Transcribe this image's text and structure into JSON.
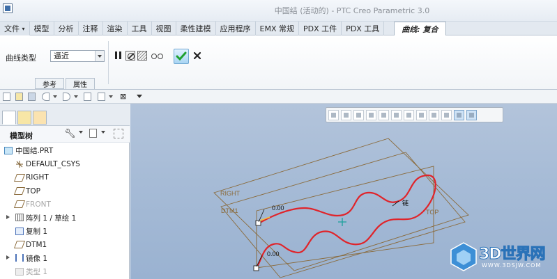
{
  "window": {
    "title": "中国结 (活动的) - PTC Creo Parametric 3.0"
  },
  "ribbon_tabs": {
    "file": "文件",
    "items": [
      "模型",
      "分析",
      "注释",
      "渲染",
      "工具",
      "视图",
      "柔性建模",
      "应用程序",
      "EMX 常规",
      "PDX 工件",
      "PDX 工具"
    ],
    "active": "曲线: 复合"
  },
  "curve_panel": {
    "type_label": "曲线类型",
    "type_value": "逼近",
    "tabs": [
      "参考",
      "属性"
    ]
  },
  "model_tree": {
    "header": "模型树",
    "items": [
      {
        "label": "中国结.PRT",
        "icon": "part-icon",
        "expand": false,
        "dim": false
      },
      {
        "label": "DEFAULT_CSYS",
        "icon": "csys-icon",
        "expand": false,
        "dim": false
      },
      {
        "label": "RIGHT",
        "icon": "datum-plane-icon",
        "expand": false,
        "dim": false
      },
      {
        "label": "TOP",
        "icon": "datum-plane-icon",
        "expand": false,
        "dim": false
      },
      {
        "label": "FRONT",
        "icon": "datum-plane-icon",
        "expand": false,
        "dim": true
      },
      {
        "label": "阵列 1 / 草绘 1",
        "icon": "pattern-icon",
        "expand": true,
        "dim": false
      },
      {
        "label": "复制 1",
        "icon": "copy-icon",
        "expand": false,
        "dim": false
      },
      {
        "label": "DTM1",
        "icon": "datum-plane-icon",
        "expand": false,
        "dim": false
      },
      {
        "label": "镜像 1",
        "icon": "mirror-icon",
        "expand": true,
        "dim": false
      },
      {
        "label": "类型 1",
        "icon": "feature-icon",
        "expand": false,
        "dim": true
      }
    ]
  },
  "viewport": {
    "plane_labels": {
      "right": "RIGHT",
      "top": "TOP",
      "dtm1": "DTM1"
    },
    "dim_upper": "0.00",
    "dim_lower": "0.00",
    "curve_note": "链"
  },
  "watermark": {
    "brand": "3D世界网",
    "url": "WWW.3DSJW.COM"
  },
  "colors": {
    "curve": "#e0242a",
    "planes": "#8a6a3a",
    "ok": "#1fa12f",
    "viewport_bg": "#a6bbd6"
  }
}
